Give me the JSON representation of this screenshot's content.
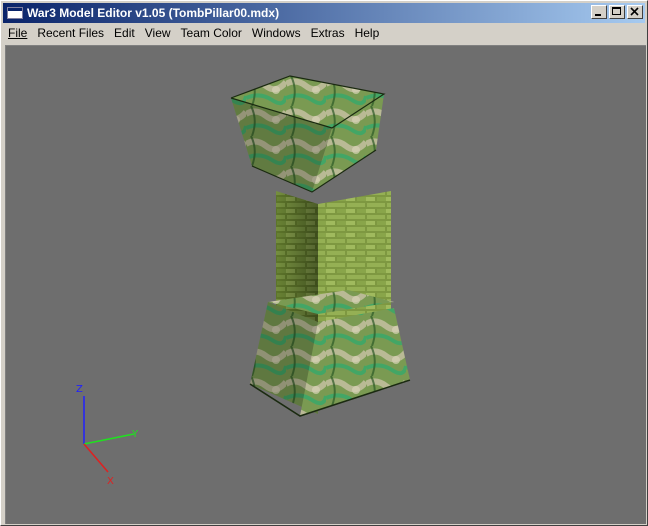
{
  "window": {
    "title": "War3 Model Editor v1.05 (TombPillar00.mdx)"
  },
  "menu": [
    {
      "label": "File",
      "name": "menu-file"
    },
    {
      "label": "Recent Files",
      "name": "menu-recent-files"
    },
    {
      "label": "Edit",
      "name": "menu-edit"
    },
    {
      "label": "View",
      "name": "menu-view"
    },
    {
      "label": "Team Color",
      "name": "menu-team-color"
    },
    {
      "label": "Windows",
      "name": "menu-windows"
    },
    {
      "label": "Extras",
      "name": "menu-extras"
    },
    {
      "label": "Help",
      "name": "menu-help"
    }
  ],
  "icons": {
    "app": "app-icon",
    "minimize": "minimize-icon",
    "maximize": "maximize-icon",
    "close": "close-icon"
  },
  "axes": {
    "z": {
      "label": "Z",
      "color": "#2020ff"
    },
    "y": {
      "label": "Y",
      "color": "#20e020"
    },
    "x": {
      "label": "X",
      "color": "#e02020"
    }
  },
  "colors": {
    "viewport_bg": "#6e6e6e",
    "title_start": "#0a246a",
    "title_end": "#a6caf0"
  }
}
